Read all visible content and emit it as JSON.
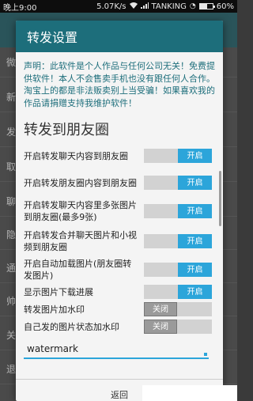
{
  "status_bar": {
    "time": "晚上9:00",
    "speed": "5.07K/s",
    "wifi_icon": "wifi-icon",
    "carrier": "TANKING",
    "battery_percent": "60%",
    "battery_level": 0.6
  },
  "background": {
    "rows": [
      {
        "label": "微"
      },
      {
        "label": "新"
      },
      {
        "label": "发"
      },
      {
        "label": "取"
      },
      {
        "label": "聊"
      },
      {
        "label": "隐"
      },
      {
        "label": "通"
      },
      {
        "label": "帅"
      },
      {
        "label": "关"
      },
      {
        "label": "退"
      }
    ]
  },
  "dialog": {
    "title": "转发设置",
    "notice": "声明：此软件是个人作品与任何公司无关！免费提供软件！本人不会售卖手机也没有跟任何人合作。淘宝上的都是非法贩卖别上当受骗！如果喜欢我的作品请捐赠支持我维护软件！",
    "section_title": "转发到朋友圈",
    "settings": [
      {
        "label": "开启转发聊天内容到朋友圈",
        "state": "on",
        "state_label": "开启"
      },
      {
        "label": "开启转发朋友圈内容到朋友圈",
        "state": "on",
        "state_label": "开启"
      },
      {
        "label": "开启转发聊天内容里多张图片到朋友圈(最多9张)",
        "state": "on",
        "state_label": "开启"
      },
      {
        "label": "开启转发合并聊天图片和小视频到朋友圈",
        "state": "on",
        "state_label": "开启"
      },
      {
        "label": "开启自动加载图片(朋友圈转发图片)",
        "state": "on",
        "state_label": "开启"
      },
      {
        "label": "显示图片下载进展",
        "state": "on",
        "state_label": "开启"
      },
      {
        "label": "转发图片加水印",
        "state": "off",
        "state_label": "关闭"
      },
      {
        "label": "自己发的图片状态加水印",
        "state": "off",
        "state_label": "关闭"
      }
    ],
    "watermark_value": "watermark",
    "footer_button": "返回"
  },
  "colors": {
    "title_bar": "#1d6e7b",
    "notice_text": "#1d6e7b",
    "toggle_on": "#2ca5da",
    "toggle_off": "#9a9a9a"
  }
}
